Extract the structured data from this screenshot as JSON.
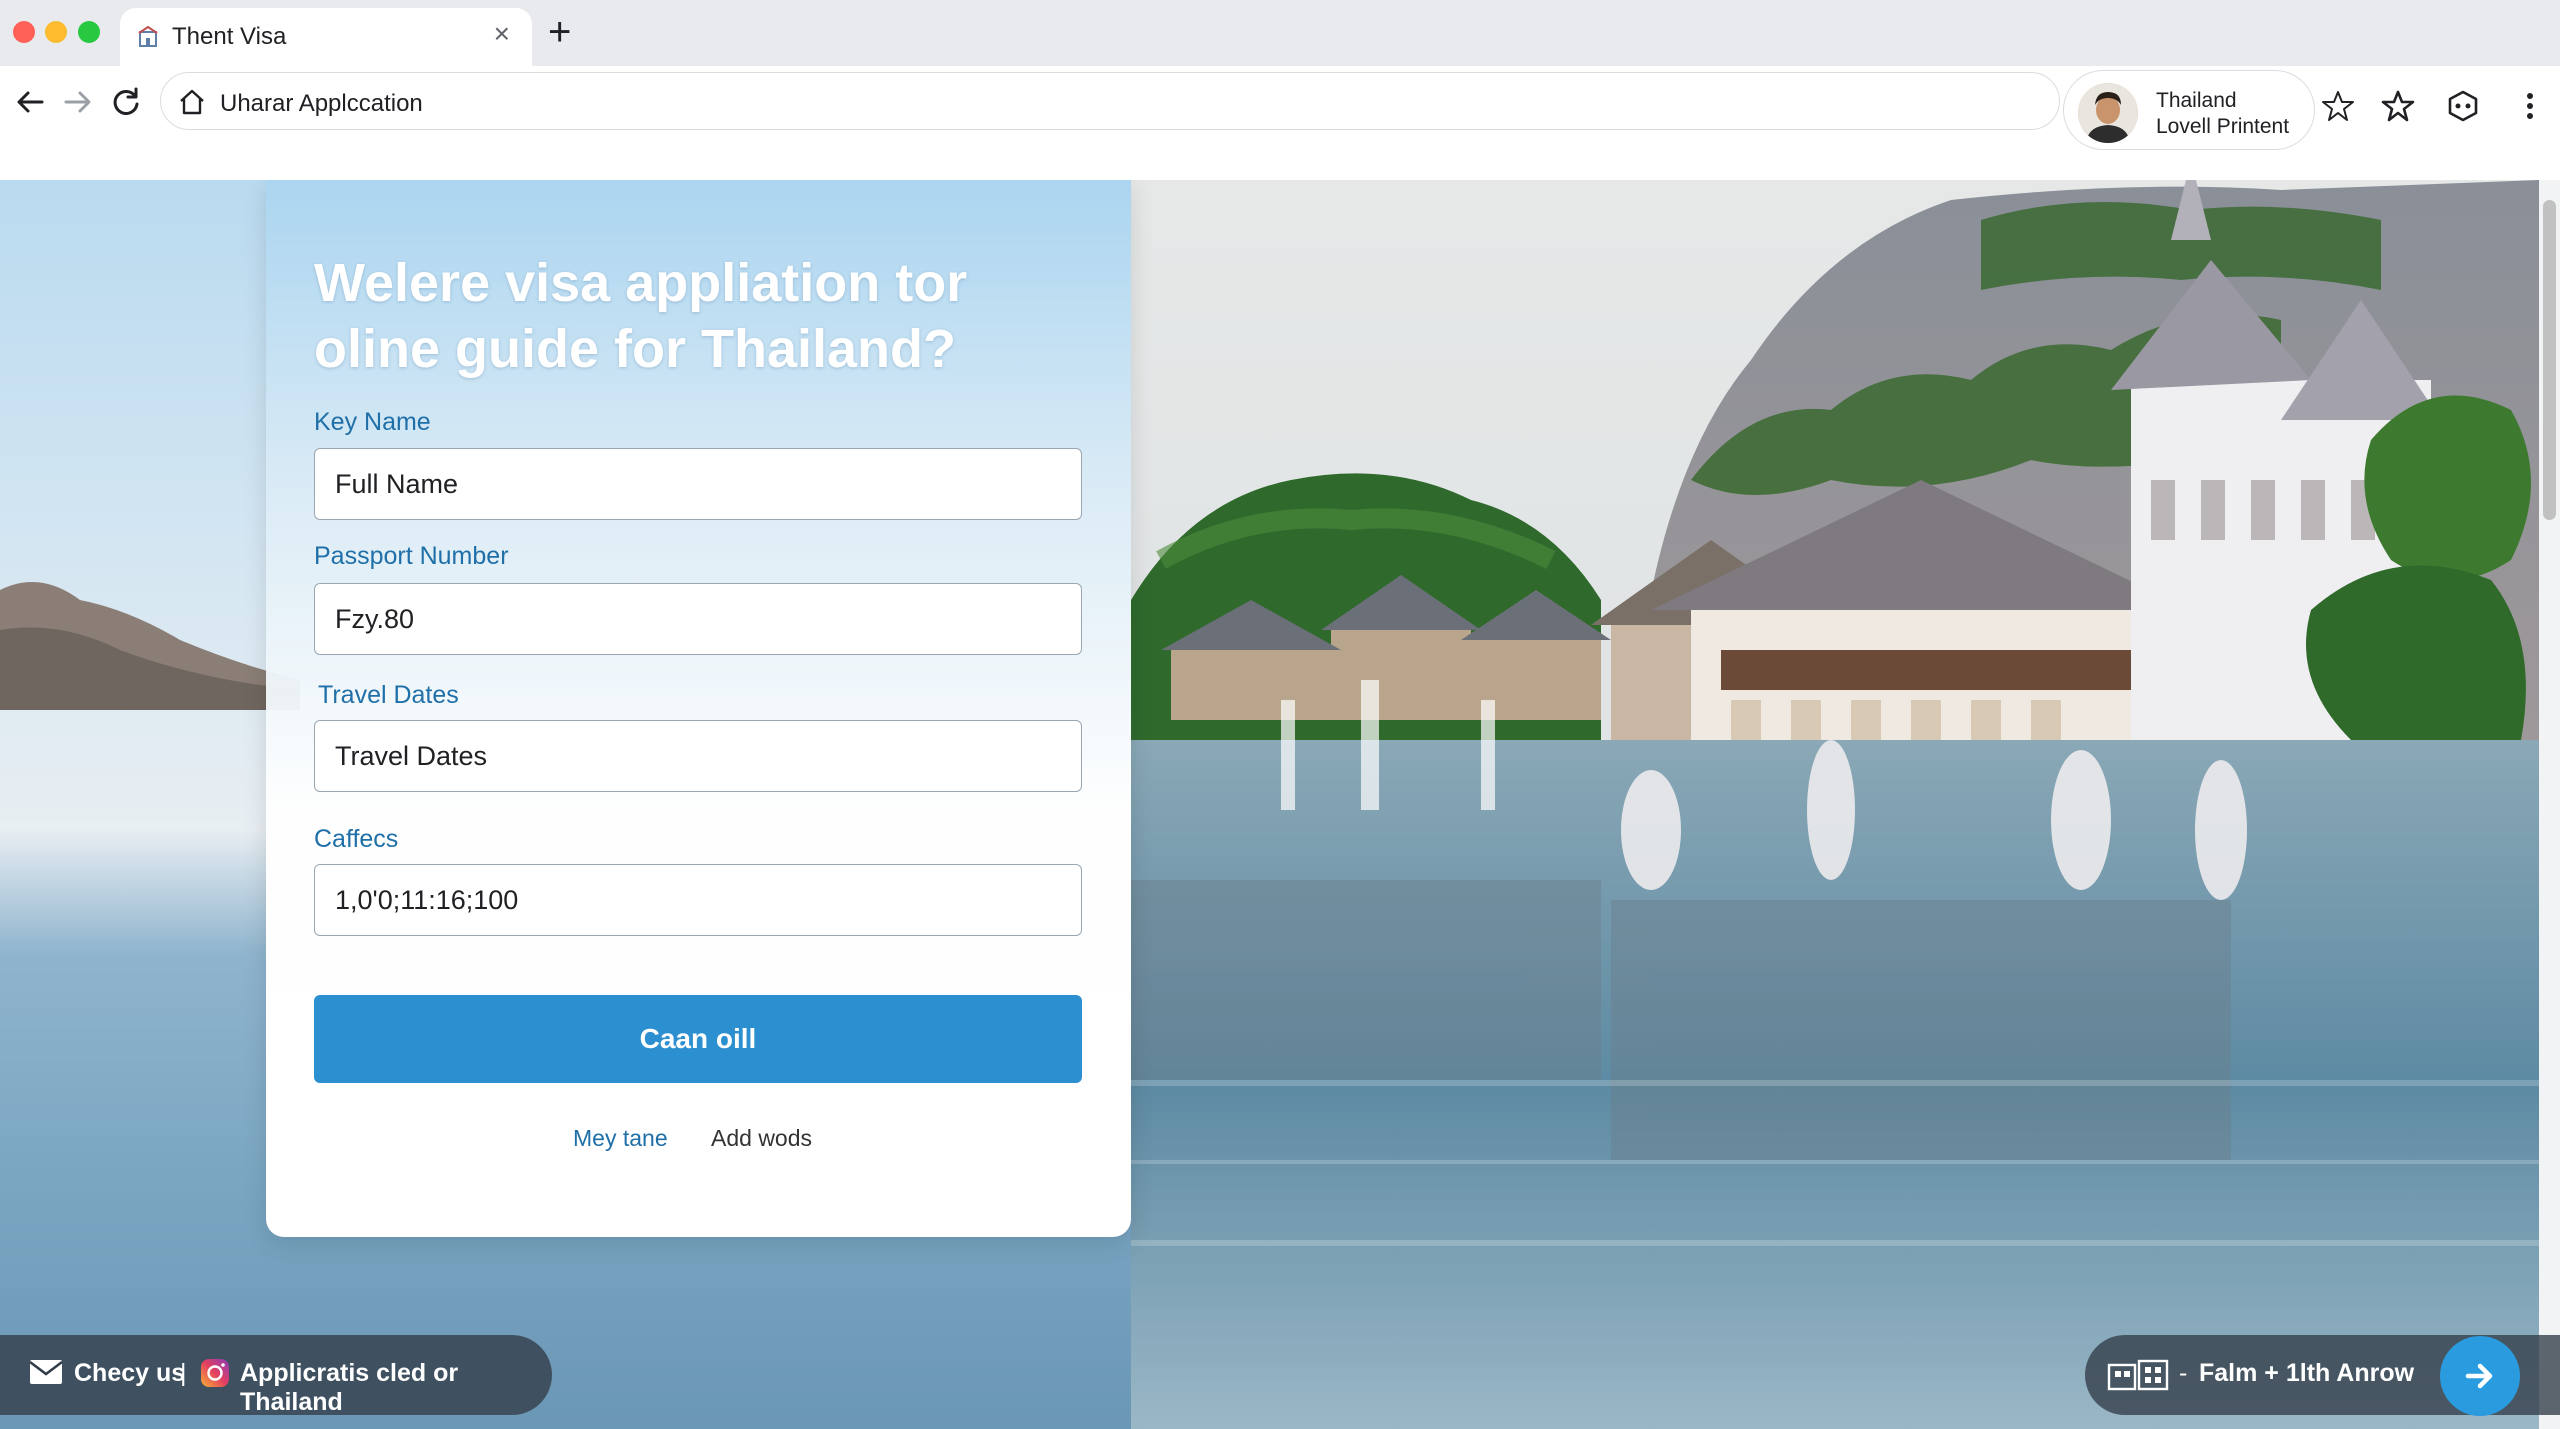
{
  "browser": {
    "tab_title": "Thent Visa",
    "address": "Uharar Applccation",
    "profile": {
      "line1": "Thailand",
      "line2": "Lovell Printent"
    }
  },
  "form": {
    "title": "Welere visa appliation tor oline guide for Thailand?",
    "fields": [
      {
        "label": "Key Name",
        "value": "Full Name"
      },
      {
        "label": "Passport Number",
        "value": "Fzy.80"
      },
      {
        "label": "Travel Dates",
        "value": "Travel Dates"
      },
      {
        "label": "Caffecs",
        "value": "1,0'0;11:16;100"
      }
    ],
    "submit_label": "Caan oill",
    "link_primary": "Mey tane",
    "link_secondary": "Add wods"
  },
  "footer": {
    "left_item1": "Checy us",
    "separator": "|",
    "left_item2": "Applicratis cled or Thailand",
    "right_dash": "-",
    "right_text": "Falm + 1lth Anrow"
  },
  "colors": {
    "accent": "#2b8fd0",
    "label": "#1f6fa8"
  },
  "icons": [
    "back-arrow-icon",
    "forward-arrow-icon",
    "reload-icon",
    "home-icon",
    "star-outline-icon",
    "star-icon",
    "extension-icon",
    "menu-dots-icon",
    "mail-icon",
    "instagram-icon",
    "building-icon",
    "arrow-right-icon"
  ]
}
